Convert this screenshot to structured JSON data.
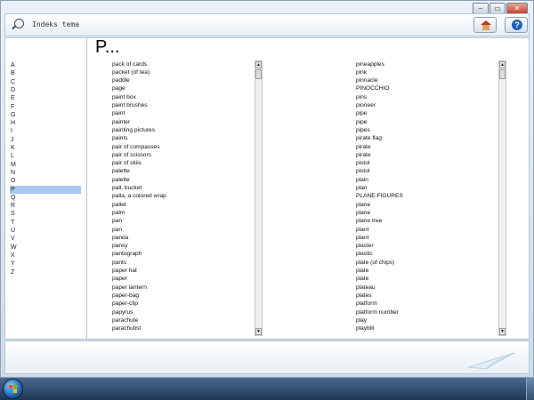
{
  "window": {
    "controls": [
      "–",
      "▭",
      "✕"
    ]
  },
  "topbar": {
    "title": "Indeks tema",
    "search_icon": "search-icon",
    "home_icon": "home-icon",
    "help_icon": "help-icon",
    "help_glyph": "?"
  },
  "alphabet": {
    "letters": [
      "A",
      "B",
      "C",
      "D",
      "E",
      "F",
      "G",
      "H",
      "I",
      "J",
      "K",
      "L",
      "M",
      "N",
      "O",
      "P",
      "Q",
      "R",
      "S",
      "T",
      "U",
      "V",
      "W",
      "X",
      "Y",
      "Z"
    ],
    "selected": "P"
  },
  "main": {
    "heading": "P..."
  },
  "list_left": [
    "pack of cards",
    "packet (of tea)",
    "paddle",
    "page",
    "paint box",
    "paint brushes",
    "paint",
    "painter",
    "painting pictures",
    "paints",
    "pair of compasses",
    "pair of scissors",
    "pair of skiis",
    "palette",
    "palette",
    "pall, bucket",
    "palla, a colored wrap",
    "pallet",
    "palm",
    "pan",
    "pan",
    "panda",
    "pansy",
    "pantograph",
    "pants",
    "paper hat",
    "paper",
    "paper lantern",
    "paper-bag",
    "paper-clip",
    "papyrus",
    "parachute",
    "parachutist"
  ],
  "list_right": [
    "pineapples",
    "pink",
    "pinnacle",
    "PINOCCHIO",
    "pins",
    "pioneer",
    "pipe",
    "pipe",
    "pipes",
    "pirate flag",
    "pirate",
    "pirate",
    "pistol",
    "pistol",
    "plain",
    "plan",
    "PLANE FIGURES",
    "plane",
    "plane",
    "plane tree",
    "plant",
    "plant",
    "plaster",
    "plastic",
    "plate (of chips)",
    "plate",
    "plate",
    "plateau",
    "plates",
    "platform",
    "platform number",
    "play",
    "playbill"
  ],
  "scrollbar": {
    "up": "▲",
    "down": "▼"
  },
  "colors": {
    "selection": "#a8c8f0",
    "frame": "#b8c7d6"
  }
}
